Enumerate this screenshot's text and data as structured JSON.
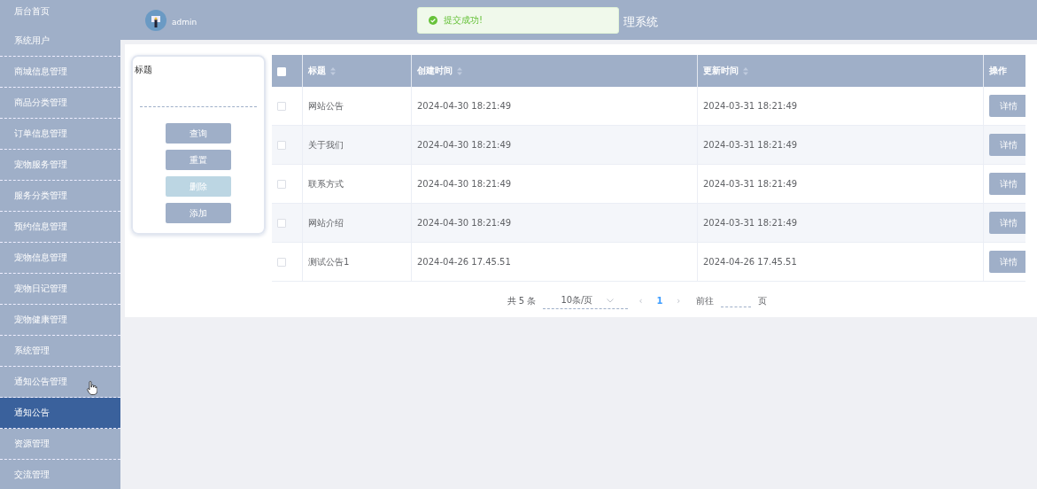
{
  "sidebar": {
    "items": [
      {
        "label": "后台首页",
        "selected": false
      },
      {
        "label": "系统用户",
        "selected": false
      },
      {
        "label": "商城信息管理",
        "selected": false
      },
      {
        "label": "商品分类管理",
        "selected": false
      },
      {
        "label": "订单信息管理",
        "selected": false
      },
      {
        "label": "宠物服务管理",
        "selected": false
      },
      {
        "label": "服务分类管理",
        "selected": false
      },
      {
        "label": "预约信息管理",
        "selected": false
      },
      {
        "label": "宠物信息管理",
        "selected": false
      },
      {
        "label": "宠物日记管理",
        "selected": false
      },
      {
        "label": "宠物健康管理",
        "selected": false
      },
      {
        "label": "系统管理",
        "selected": false
      },
      {
        "label": "通知公告管理",
        "selected": false
      },
      {
        "label": "通知公告",
        "selected": true
      },
      {
        "label": "资源管理",
        "selected": false
      },
      {
        "label": "交流管理",
        "selected": false
      }
    ]
  },
  "header": {
    "user": "admin",
    "title": "理系统"
  },
  "toast": {
    "kind": "success",
    "message": "提交成功!"
  },
  "search": {
    "label": "标题",
    "buttons": [
      {
        "label": "查询",
        "disabled": false
      },
      {
        "label": "重置",
        "disabled": false
      },
      {
        "label": "删除",
        "disabled": true
      },
      {
        "label": "添加",
        "disabled": false
      }
    ]
  },
  "table": {
    "select_all_checked": false,
    "columns": [
      {
        "label": "标题",
        "sortable": true
      },
      {
        "label": "创建时间",
        "sortable": true
      },
      {
        "label": "更新时间",
        "sortable": true
      },
      {
        "label": "操作",
        "sortable": false
      }
    ],
    "rows": [
      {
        "checked": false,
        "title": "网站公告",
        "created": "2024-04-30 18:21:49",
        "updated": "2024-03-31 18:21:49",
        "action": "详情"
      },
      {
        "checked": false,
        "title": "关于我们",
        "created": "2024-04-30 18:21:49",
        "updated": "2024-03-31 18:21:49",
        "action": "详情"
      },
      {
        "checked": false,
        "title": "联系方式",
        "created": "2024-04-30 18:21:49",
        "updated": "2024-03-31 18:21:49",
        "action": "详情"
      },
      {
        "checked": false,
        "title": "网站介绍",
        "created": "2024-04-30 18:21:49",
        "updated": "2024-03-31 18:21:49",
        "action": "详情"
      },
      {
        "checked": false,
        "title": "测试公告1",
        "created": "2024-04-26 17.45.51",
        "updated": "2024-04-26 17.45.51",
        "action": "详情"
      }
    ]
  },
  "pagination": {
    "total": "共 5 条",
    "page_size": "10条/页",
    "prev": "‹",
    "pages": [
      {
        "label": "1",
        "selected": true
      }
    ],
    "next": "›",
    "goto": "前往",
    "page_unit": "页"
  }
}
